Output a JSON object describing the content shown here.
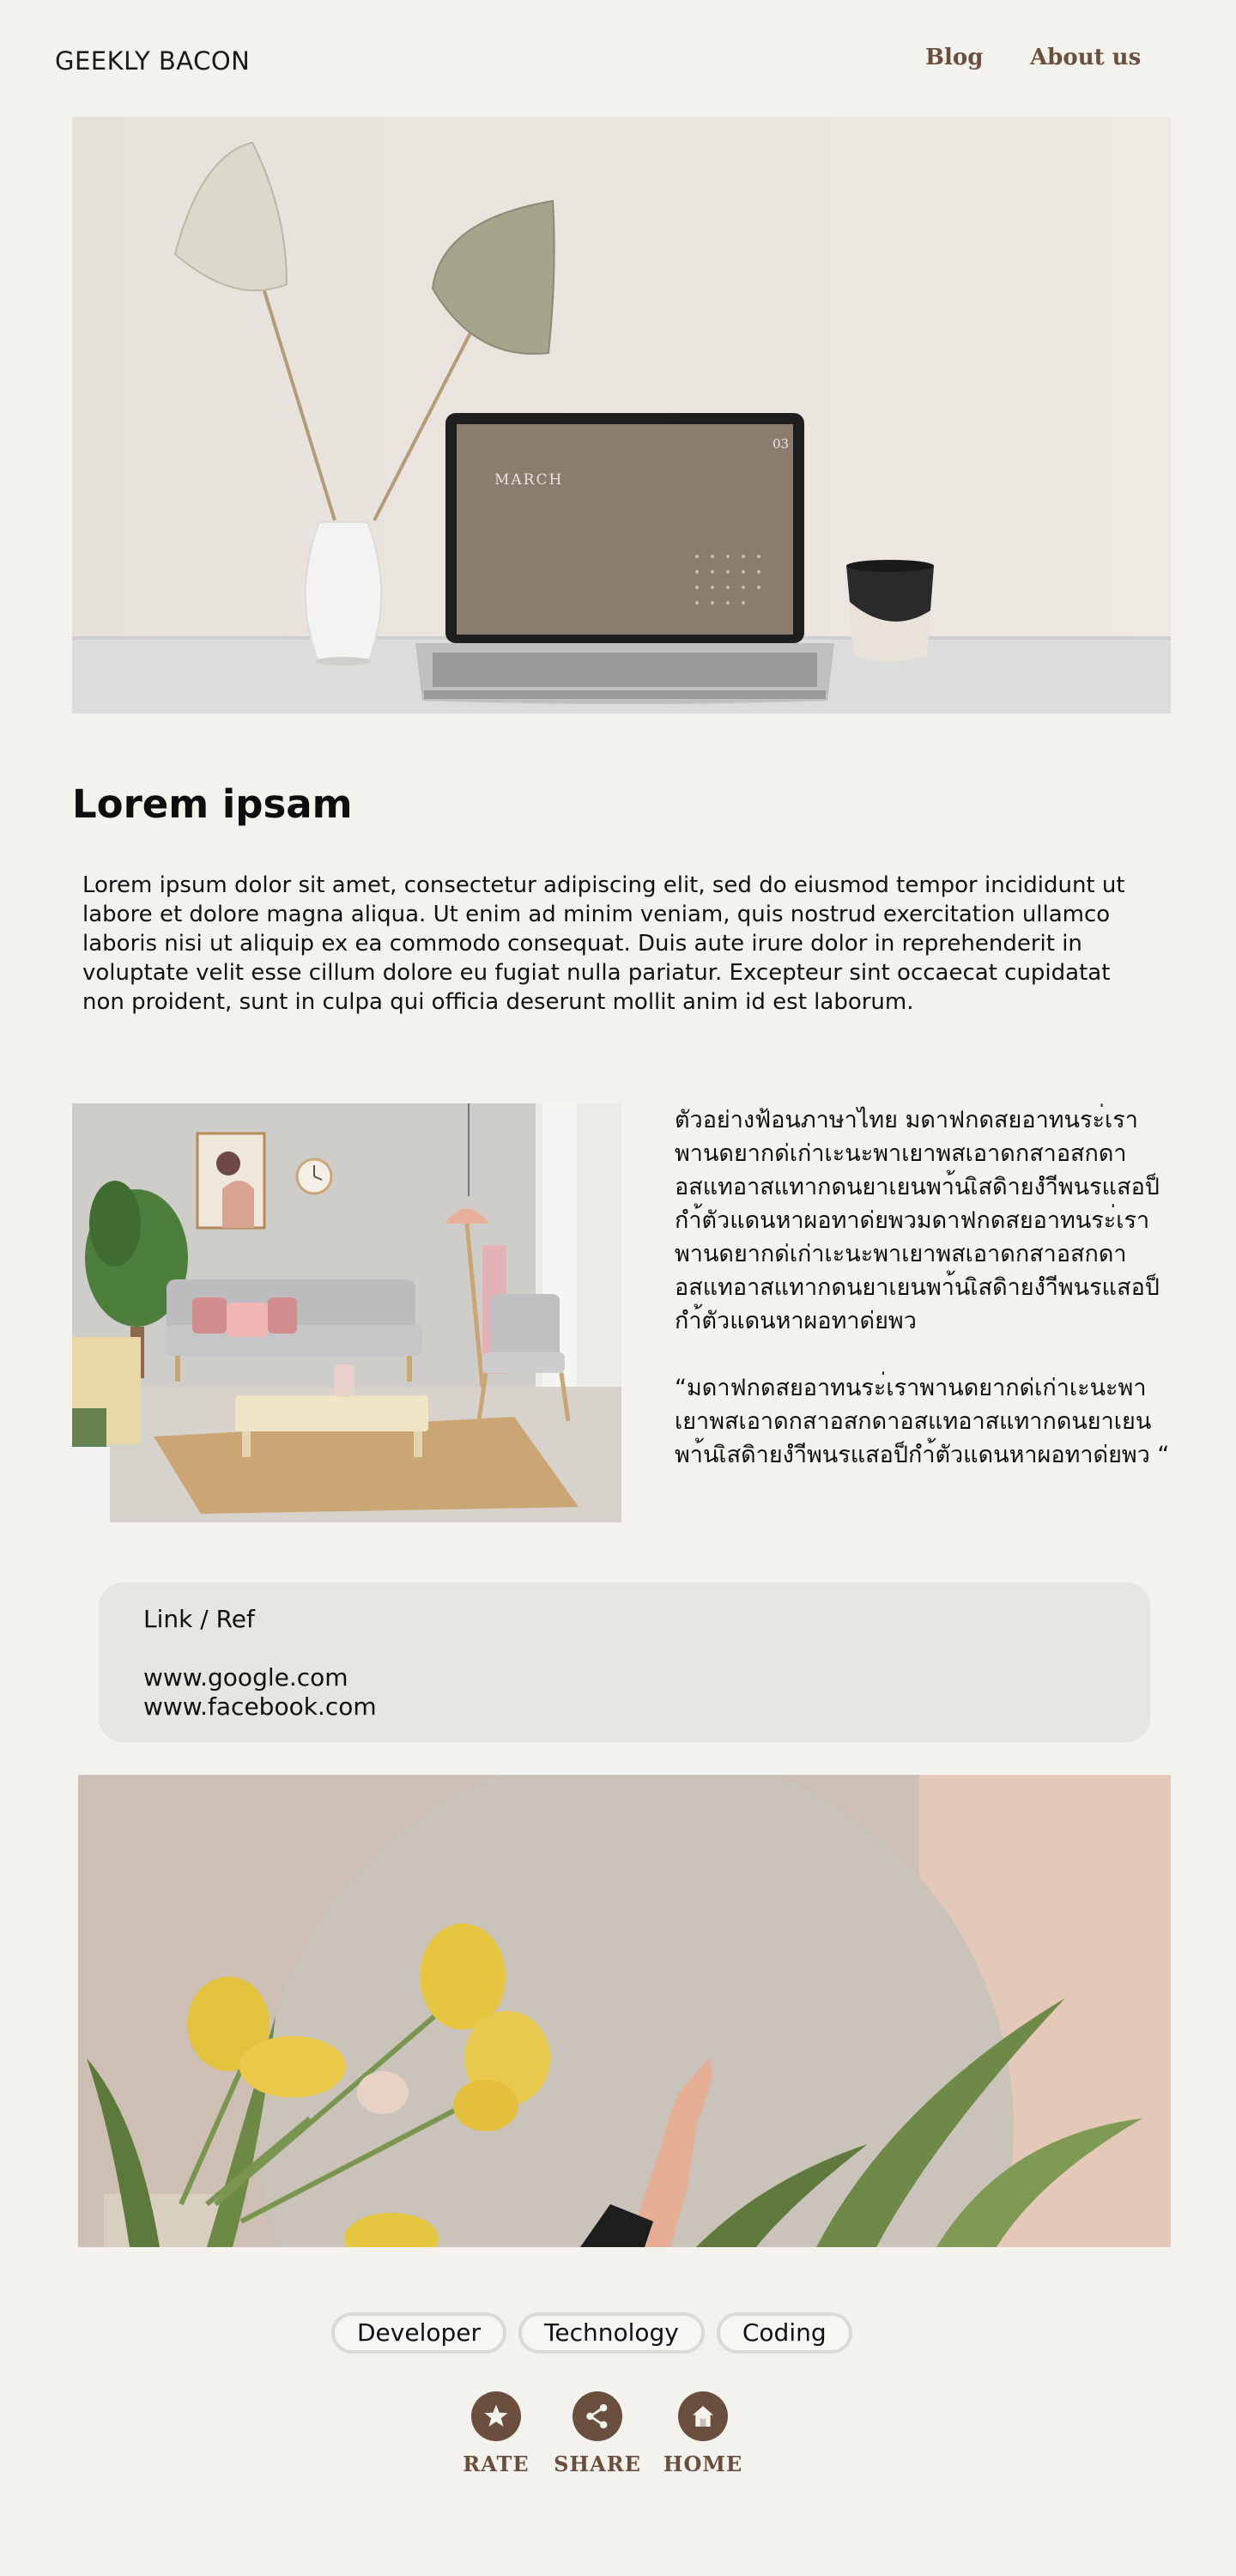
{
  "header": {
    "logo": "GEEKLY BACON",
    "nav": [
      "Blog",
      "About us"
    ]
  },
  "hero": {
    "laptop_month": "MARCH",
    "laptop_day": "03"
  },
  "article": {
    "title": "Lorem ipsam",
    "intro": "Lorem ipsum dolor sit amet, consectetur adipiscing elit, sed do eiusmod tempor incididunt ut labore et dolore magna aliqua. Ut enim ad minim veniam, quis nostrud exercitation ullamco laboris nisi ut aliquip ex ea commodo consequat. Duis aute irure dolor in reprehenderit in voluptate velit esse cillum dolore eu fugiat nulla pariatur. Excepteur sint occaecat cupidatat non proident, sunt in culpa qui officia deserunt mollit anim id est laborum.",
    "thai_paragraph": "ตัวอย่างฟ้อนภาษาไทย มดาฟกดสยอาทนระ่เราพานดยากด่เก่าเะนะพาเยาพสเอาดกสาอสกดาอสแทอาสแทากดนยาเยนพา้นเิสดิายงำีพนรแสอป็กำ้ตัวแดนหาผอทาด่ยพวมดาฟกดสยอาทนระ่เราพานดยากด่เก่าเะนะพาเยาพสเอาดกสาอสกดาอสแทอาสแทากดนยาเยนพา้นเิสดิายงำีพนรแสอป็กำ้ตัวแดนหาผอทาด่ยพว",
    "thai_quote": "“มดาฟกดสยอาทนระ่เราพานดยากด่เก่าเะนะพาเยาพสเอาดกสาอสกดาอสแทอาสแทากดนยาเยนพา้นเิสดิายงำีพนรแสอป็กำ้ตัวแดนหาผอทาด่ยพว “"
  },
  "refs": {
    "heading": "Link / Ref",
    "links": [
      "www.google.com",
      "www.facebook.com"
    ]
  },
  "tags": [
    "Developer",
    "Technology",
    "Coding"
  ],
  "actions": {
    "rate": {
      "label": "RATE",
      "icon": "star-icon"
    },
    "share": {
      "label": "SHARE",
      "icon": "share-icon"
    },
    "home": {
      "label": "HOME",
      "icon": "home-icon"
    }
  },
  "colors": {
    "background": "#f4f2ec",
    "accent": "#6a4f3f",
    "ref_box": "#e7e5e0",
    "tag_border": "#dcdad4"
  }
}
